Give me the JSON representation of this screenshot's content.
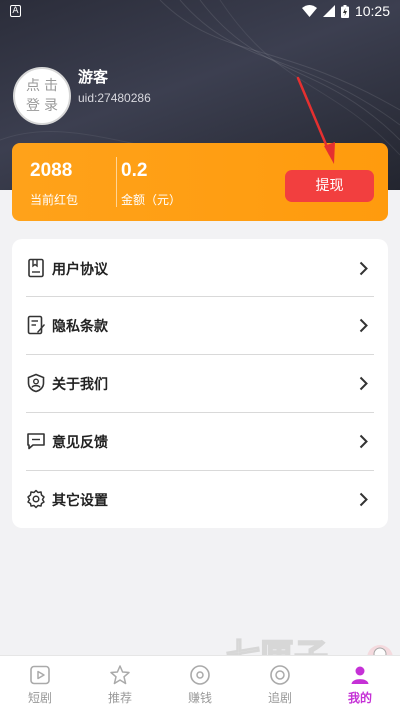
{
  "status_bar": {
    "time": "10:25",
    "notif_letter": "A"
  },
  "profile": {
    "avatar_text": "点击登录",
    "name": "游客",
    "uid": "uid:27480286"
  },
  "wallet": {
    "red_packet_value": "2088",
    "red_packet_label": "当前红包",
    "amount_value": "0.2",
    "amount_label": "金额（元）",
    "withdraw_label": "提现"
  },
  "menu": {
    "items": [
      {
        "label": "用户协议",
        "icon": "document-icon"
      },
      {
        "label": "隐私条款",
        "icon": "edit-document-icon"
      },
      {
        "label": "关于我们",
        "icon": "shield-user-icon"
      },
      {
        "label": "意见反馈",
        "icon": "message-icon"
      },
      {
        "label": "其它设置",
        "icon": "gear-icon"
      }
    ]
  },
  "tabbar": {
    "tabs": [
      {
        "label": "短剧",
        "icon": "play-icon"
      },
      {
        "label": "推荐",
        "icon": "star-icon"
      },
      {
        "label": "赚钱",
        "icon": "coin-icon"
      },
      {
        "label": "追剧",
        "icon": "record-icon"
      },
      {
        "label": "我的",
        "icon": "user-icon",
        "active": true
      }
    ]
  },
  "watermark": {
    "text": "七匣子"
  },
  "colors": {
    "accent_orange": "#ffa21a",
    "withdraw_red": "#f23f3f",
    "active_tab": "#c531d6",
    "arrow_red": "#e53030"
  }
}
